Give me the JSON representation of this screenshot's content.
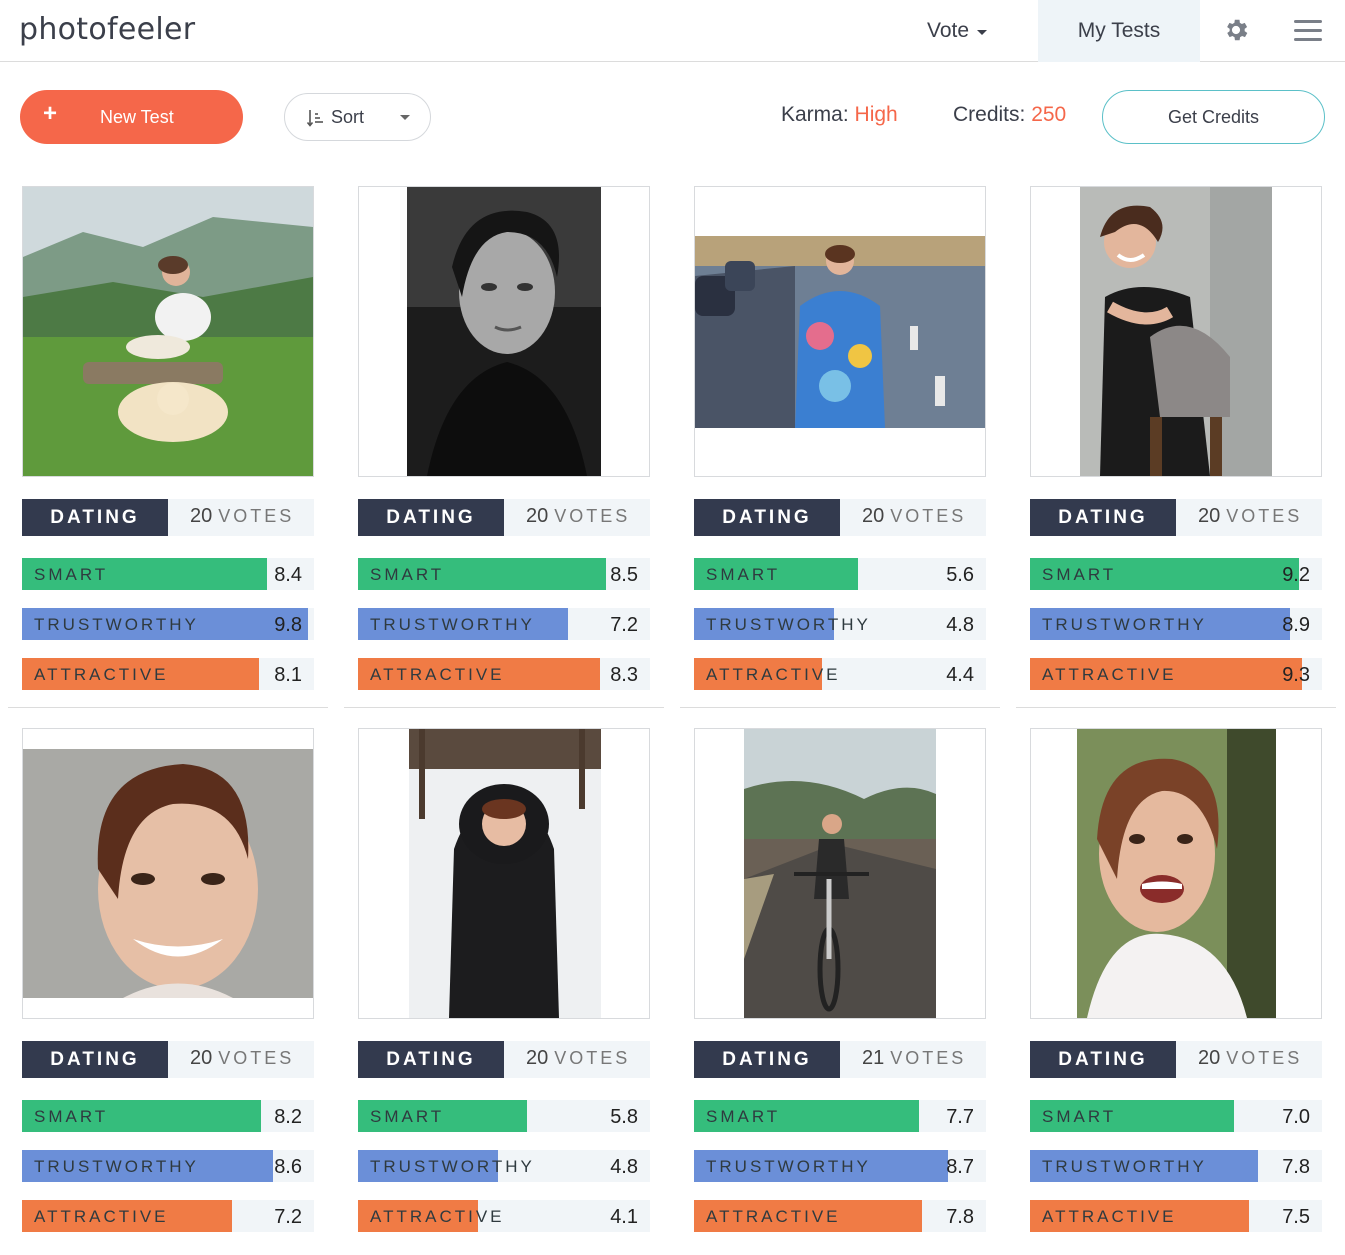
{
  "header": {
    "logo": "photofeeler",
    "nav_vote": "Vote",
    "nav_my_tests": "My Tests",
    "gear_icon": "gear-icon",
    "menu_icon": "hamburger-menu-icon"
  },
  "toolbar": {
    "new_test_plus": "+",
    "new_test_label": "New Test",
    "sort_label": "Sort",
    "karma_label": "Karma:",
    "karma_value": "High",
    "credits_label": "Credits:",
    "credits_value": "250",
    "get_credits_label": "Get Credits"
  },
  "colors": {
    "accent": "#f5674a",
    "smart": "#35bd7c",
    "trustworthy": "#6b8fd8",
    "attractive": "#f07b45",
    "category_badge": "#333a4e"
  },
  "labels": {
    "smart": "SMART",
    "trustworthy": "TRUSTWORTHY",
    "attractive": "ATTRACTIVE",
    "votes_word": "VOTES"
  },
  "tests": [
    {
      "category": "DATING",
      "votes": "20",
      "smart": "8.4",
      "trustworthy": "9.8",
      "attractive": "8.1"
    },
    {
      "category": "DATING",
      "votes": "20",
      "smart": "8.5",
      "trustworthy": "7.2",
      "attractive": "8.3"
    },
    {
      "category": "DATING",
      "votes": "20",
      "smart": "5.6",
      "trustworthy": "4.8",
      "attractive": "4.4"
    },
    {
      "category": "DATING",
      "votes": "20",
      "smart": "9.2",
      "trustworthy": "8.9",
      "attractive": "9.3"
    },
    {
      "category": "DATING",
      "votes": "20",
      "smart": "8.2",
      "trustworthy": "8.6",
      "attractive": "7.2"
    },
    {
      "category": "DATING",
      "votes": "20",
      "smart": "5.8",
      "trustworthy": "4.8",
      "attractive": "4.1"
    },
    {
      "category": "DATING",
      "votes": "21",
      "smart": "7.7",
      "trustworthy": "8.7",
      "attractive": "7.8"
    },
    {
      "category": "DATING",
      "votes": "20",
      "smart": "7.0",
      "trustworthy": "7.8",
      "attractive": "7.5"
    }
  ]
}
